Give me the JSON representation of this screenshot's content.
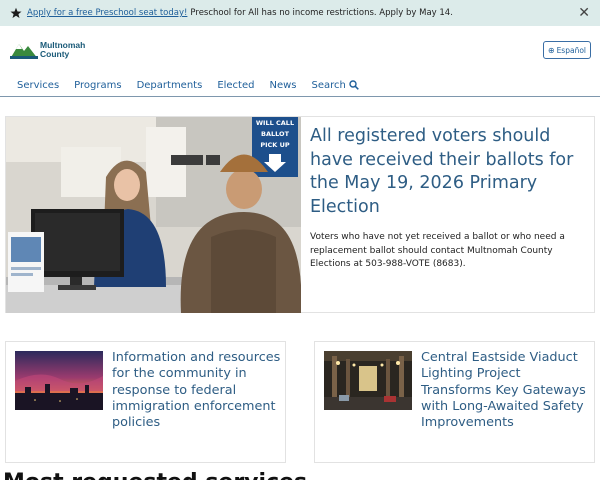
{
  "alert": {
    "link_text": "Apply for a free Preschool seat today!",
    "text": "Preschool for All has no income restrictions. Apply by May 14.",
    "icon": "star-icon",
    "close_icon": "close-icon"
  },
  "header": {
    "logo_line1": "Multnomah",
    "logo_line2": "County",
    "language_button": "Español",
    "language_icon": "globe-icon"
  },
  "nav": {
    "items": [
      "Services",
      "Programs",
      "Departments",
      "Elected",
      "News",
      "Search"
    ]
  },
  "hero": {
    "title": "All registered voters should have received their ballots for the May 19, 2026 Primary Election",
    "body": "Voters who have not yet received a ballot or who need a replacement ballot should contact Multnomah County Elections at 503-988-VOTE (8683).",
    "sign_text_1": "WILL CALL",
    "sign_text_2": "BALLOT",
    "sign_text_3": "PICK UP"
  },
  "cards": [
    {
      "title": "Information and resources for the community in response to federal immigration enforcement policies"
    },
    {
      "title": "Central Eastside Viaduct Lighting Project Transforms Key Gateways with Long-Awaited Safety Improvements"
    }
  ],
  "section": {
    "heading": "Most requested services"
  },
  "colors": {
    "alert_bg": "#dcebea",
    "link": "#1f5f9a",
    "heading": "#2e5d84",
    "logo_green": "#3a8a3e",
    "logo_blue": "#1a5a78"
  }
}
